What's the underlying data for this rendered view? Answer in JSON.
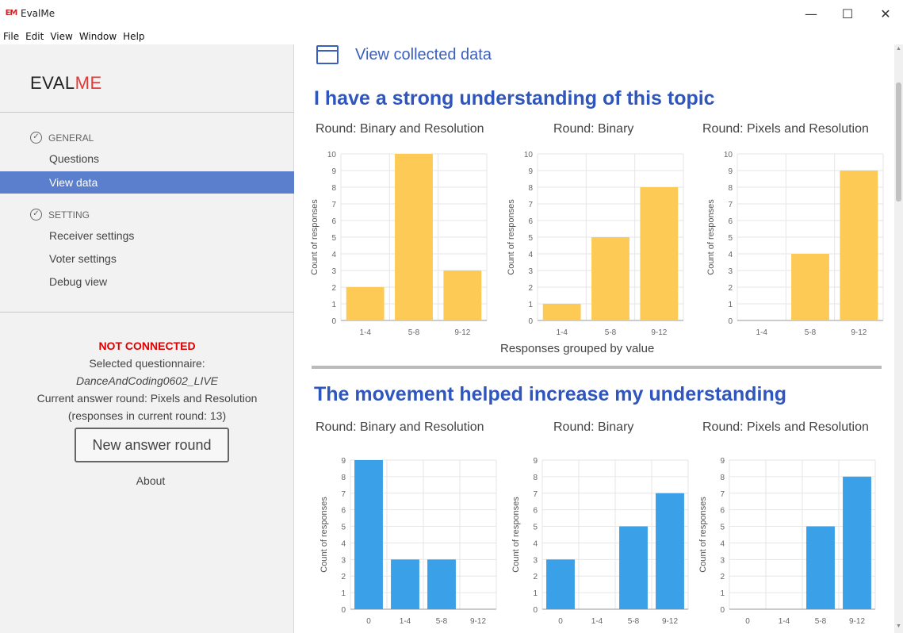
{
  "window": {
    "icon_text": "EM",
    "title": "EvalMe",
    "minimize": "—",
    "maximize": "☐",
    "close": "✕"
  },
  "menu": [
    "File",
    "Edit",
    "View",
    "Window",
    "Help"
  ],
  "sidebar": {
    "brand_a": "EVAL",
    "brand_b": "ME",
    "general": {
      "label": "GENERAL",
      "items": [
        {
          "label": "Questions"
        },
        {
          "label": "View data"
        }
      ]
    },
    "setting": {
      "label": "SETTING",
      "items": [
        {
          "label": "Receiver settings"
        },
        {
          "label": "Voter settings"
        },
        {
          "label": "Debug view"
        }
      ]
    },
    "status": {
      "connection": "NOT CONNECTED",
      "selected_label": "Selected questionnaire:",
      "questionnaire": "DanceAndCoding0602_LIVE",
      "round_line": "Current answer round: Pixels and Resolution",
      "responses_line": "(responses in current round: 13)"
    },
    "new_round_button": "New answer round",
    "about": "About"
  },
  "main": {
    "header": "View collected data",
    "x_group_label": "Responses grouped by value"
  },
  "colors": {
    "accent": "#5b7fcc",
    "title_blue": "#2f56bd",
    "bar_yellow": "#fdca55",
    "bar_blue": "#3aa0e8",
    "error_red": "#e00000"
  },
  "chart_data": [
    {
      "question": "I have a strong understanding of this topic",
      "round": "Round: Binary and Resolution",
      "type": "bar",
      "categories": [
        "1-4",
        "5-8",
        "9-12"
      ],
      "values": [
        2,
        10,
        3
      ],
      "ylabel": "Count of responses",
      "ylim": [
        0,
        10
      ]
    },
    {
      "question": "I have a strong understanding of this topic",
      "round": "Round: Binary",
      "type": "bar",
      "categories": [
        "1-4",
        "5-8",
        "9-12"
      ],
      "values": [
        1,
        5,
        8
      ],
      "ylabel": "Count of responses",
      "ylim": [
        0,
        10
      ]
    },
    {
      "question": "I have a strong understanding of this topic",
      "round": "Round: Pixels and Resolution",
      "type": "bar",
      "categories": [
        "1-4",
        "5-8",
        "9-12"
      ],
      "values": [
        0,
        4,
        9
      ],
      "ylabel": "Count of responses",
      "ylim": [
        0,
        10
      ]
    },
    {
      "question": "The movement helped increase my understanding",
      "round": "Round: Binary and Resolution",
      "type": "bar",
      "categories": [
        "0",
        "1-4",
        "5-8",
        "9-12"
      ],
      "values": [
        9,
        3,
        3,
        0
      ],
      "ylabel": "Count of responses",
      "ylim": [
        0,
        9
      ]
    },
    {
      "question": "The movement helped increase my understanding",
      "round": "Round: Binary",
      "type": "bar",
      "categories": [
        "0",
        "1-4",
        "5-8",
        "9-12"
      ],
      "values": [
        3,
        0,
        5,
        7
      ],
      "ylabel": "Count of responses",
      "ylim": [
        0,
        9
      ]
    },
    {
      "question": "The movement helped increase my understanding",
      "round": "Round: Pixels and Resolution",
      "type": "bar",
      "categories": [
        "0",
        "1-4",
        "5-8",
        "9-12"
      ],
      "values": [
        0,
        0,
        5,
        8
      ],
      "ylabel": "Count of responses",
      "ylim": [
        0,
        9
      ]
    }
  ]
}
